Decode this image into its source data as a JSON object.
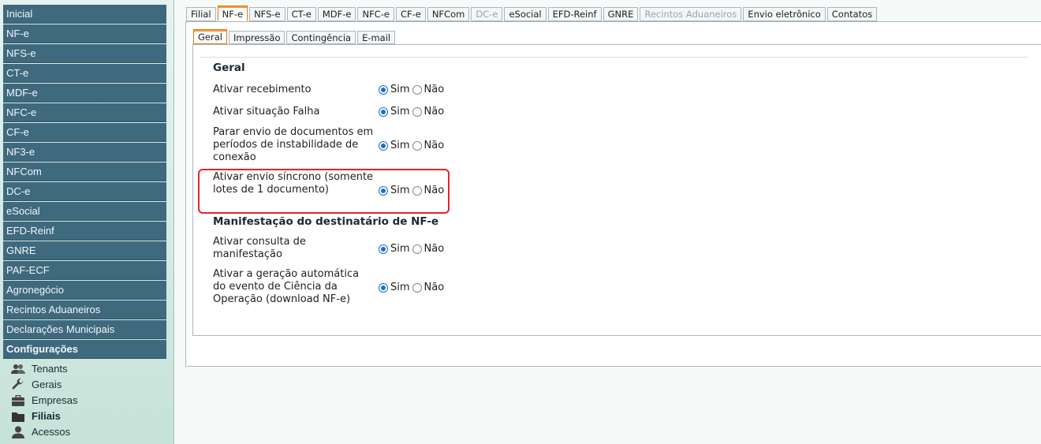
{
  "sidebar": {
    "menu": [
      {
        "label": "Inicial"
      },
      {
        "label": "NF-e"
      },
      {
        "label": "NFS-e"
      },
      {
        "label": "CT-e"
      },
      {
        "label": "MDF-e"
      },
      {
        "label": "NFC-e"
      },
      {
        "label": "CF-e"
      },
      {
        "label": "NF3-e"
      },
      {
        "label": "NFCom"
      },
      {
        "label": "DC-e"
      },
      {
        "label": "eSocial"
      },
      {
        "label": "EFD-Reinf"
      },
      {
        "label": "GNRE"
      },
      {
        "label": "PAF-ECF"
      },
      {
        "label": "Agronegócio"
      },
      {
        "label": "Recintos Aduaneiros"
      },
      {
        "label": "Declarações Municipais"
      },
      {
        "label": "Configurações"
      }
    ],
    "submenu": [
      {
        "label": "Tenants",
        "icon": "users-icon"
      },
      {
        "label": "Gerais",
        "icon": "wrench-icon"
      },
      {
        "label": "Empresas",
        "icon": "briefcase-icon"
      },
      {
        "label": "Filiais",
        "icon": "folder-icon"
      },
      {
        "label": "Acessos",
        "icon": "user-icon"
      }
    ]
  },
  "tabs": [
    {
      "label": "Filial"
    },
    {
      "label": "NF-e"
    },
    {
      "label": "NFS-e"
    },
    {
      "label": "CT-e"
    },
    {
      "label": "MDF-e"
    },
    {
      "label": "NFC-e"
    },
    {
      "label": "CF-e"
    },
    {
      "label": "NFCom"
    },
    {
      "label": "DC-e"
    },
    {
      "label": "eSocial"
    },
    {
      "label": "EFD-Reinf"
    },
    {
      "label": "GNRE"
    },
    {
      "label": "Recintos Aduaneiros"
    },
    {
      "label": "Envio eletrônico"
    },
    {
      "label": "Contatos"
    }
  ],
  "subtabs": [
    {
      "label": "Geral"
    },
    {
      "label": "Impressão"
    },
    {
      "label": "Contingência"
    },
    {
      "label": "E-mail"
    }
  ],
  "form": {
    "section_geral": "Geral",
    "section_manifestacao": "Manifestação do destinatário de NF-e",
    "option_yes": "Sim",
    "option_no": "Não",
    "rows": [
      {
        "label": "Ativar recebimento",
        "value": "Sim"
      },
      {
        "label": "Ativar situação Falha",
        "value": "Sim"
      },
      {
        "label": "Parar envio de documentos em períodos de instabilidade de conexão",
        "value": "Sim"
      },
      {
        "label": "Ativar envio síncrono (somente lotes de 1 documento)",
        "value": "Sim"
      },
      {
        "label": "Ativar consulta de manifestação",
        "value": "Sim"
      },
      {
        "label": "Ativar a geração automática do evento de Ciência da Operação (download NF-e)",
        "value": "Sim"
      }
    ]
  },
  "colors": {
    "menu_bg": "#3f6a7e",
    "active_tab_accent": "#e07a1a",
    "highlight": "#e2232d",
    "radio_selected": "#1a6fd0"
  }
}
